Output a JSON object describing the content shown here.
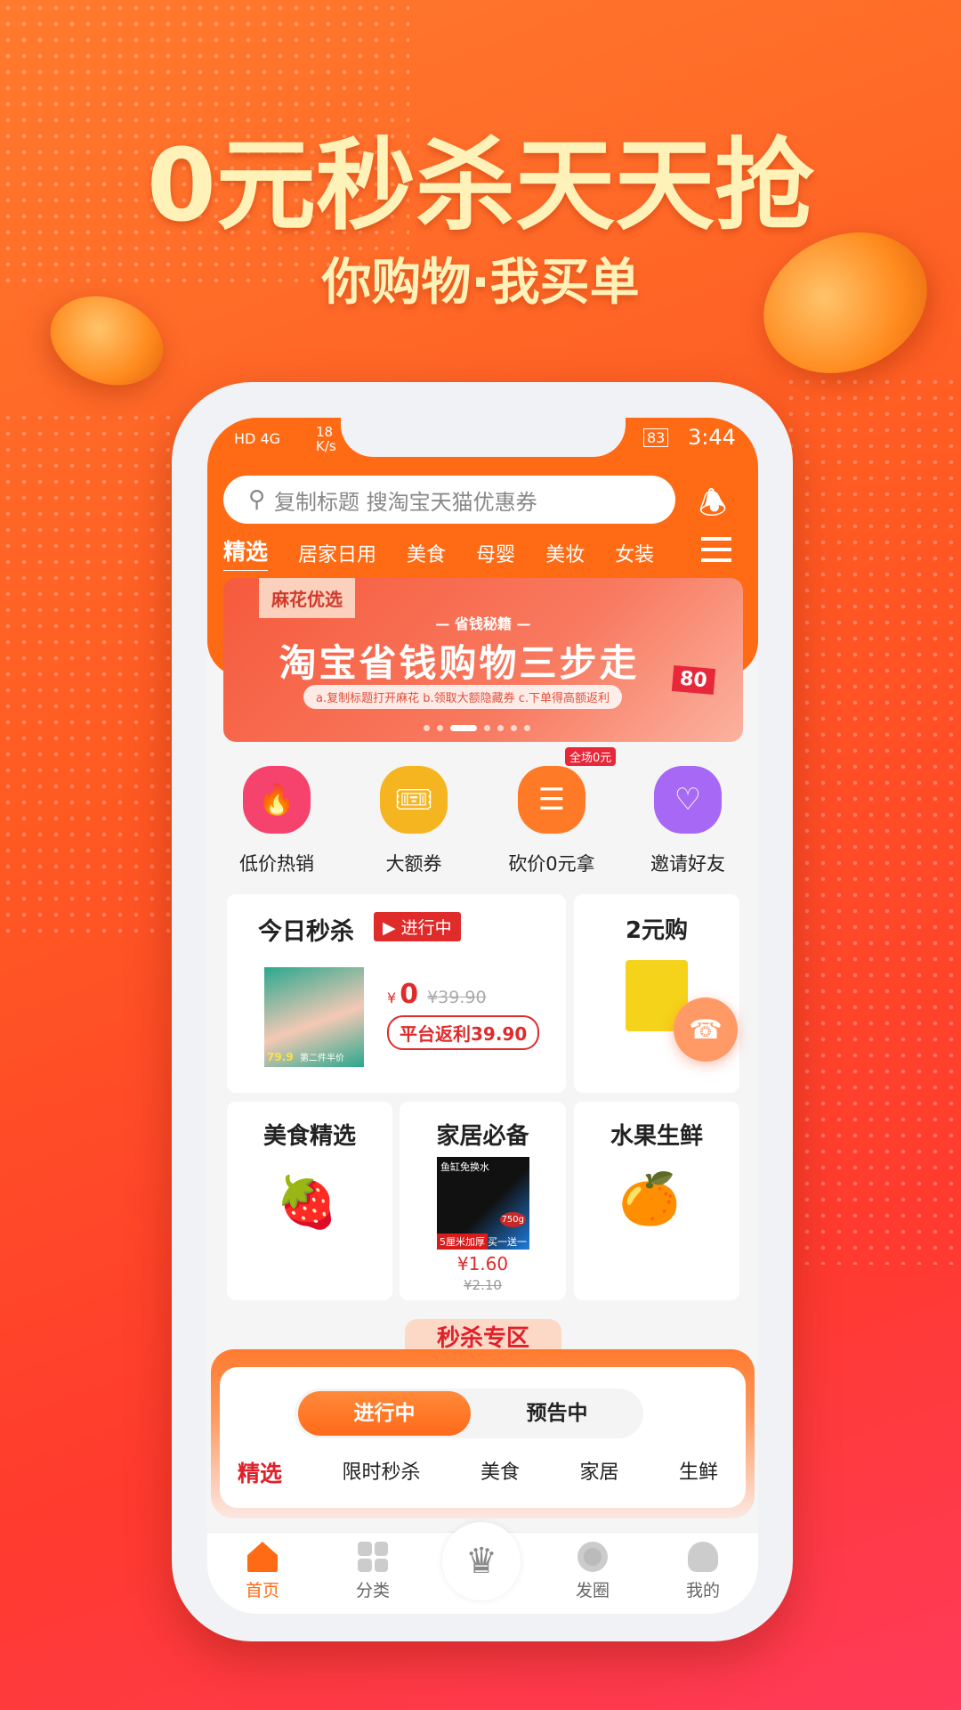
{
  "hero": {
    "title": "0元秒杀天天抢",
    "subtitle": "你购物·我买单"
  },
  "status_bar": {
    "left": "HD 4G",
    "speed": "18 K/s",
    "battery": "83",
    "time": "3:44"
  },
  "search": {
    "placeholder": "复制标题  搜淘宝天猫优惠券",
    "icon": "search-icon"
  },
  "tabs": [
    {
      "label": "精选",
      "active": true
    },
    {
      "label": "居家日用"
    },
    {
      "label": "美食"
    },
    {
      "label": "母婴"
    },
    {
      "label": "美妆"
    },
    {
      "label": "女装"
    }
  ],
  "banner": {
    "tag": "麻花优选",
    "kicker": "— 省钱秘籍 —",
    "title": "淘宝省钱购物三步走",
    "steps": "a.复制标题打开麻花 b.领取大额隐藏券 c.下单得高额返利",
    "coupon": "80",
    "active_dot": 2,
    "dot_count": 7
  },
  "quick": [
    {
      "label": "低价热销",
      "icon": "flame-icon",
      "color": "#f5436e"
    },
    {
      "label": "大额券",
      "icon": "ticket-icon",
      "color": "#f5b520"
    },
    {
      "label": "砍价0元拿",
      "icon": "coins-icon",
      "color": "#ff7a26",
      "badge": "全场0元"
    },
    {
      "label": "邀请好友",
      "icon": "invite-friend-icon",
      "color": "#a668f5"
    }
  ],
  "flash": {
    "title": "今日秒杀",
    "status": "进行中",
    "price_symbol": "¥",
    "price": "0",
    "original": "¥39.90",
    "rebate": "平台返利39.90",
    "product_price_tag": "79.9",
    "product_caption": "第二件半价"
  },
  "two_yuan": {
    "title": "2元购"
  },
  "categories": [
    {
      "title": "美食精选"
    },
    {
      "title": "家居必备",
      "price": "¥1.60",
      "original": "¥2.10",
      "tag": "鱼缸免换水",
      "sub": "5厘米加厚",
      "promo": "买一送一",
      "weight": "750g"
    },
    {
      "title": "水果生鲜"
    }
  ],
  "zone": {
    "title": "秒杀专区",
    "toggle": [
      {
        "label": "进行中",
        "active": true
      },
      {
        "label": "预告中"
      }
    ],
    "tabs": [
      {
        "label": "精选",
        "active": true
      },
      {
        "label": "限时秒杀"
      },
      {
        "label": "美食"
      },
      {
        "label": "家居"
      },
      {
        "label": "生鲜"
      }
    ]
  },
  "nav": [
    {
      "label": "首页",
      "active": true,
      "icon": "home-icon"
    },
    {
      "label": "分类",
      "icon": "category-icon"
    },
    {
      "label": "",
      "icon": "crown-icon"
    },
    {
      "label": "发圈",
      "icon": "share-circle-icon"
    },
    {
      "label": "我的",
      "icon": "profile-icon"
    }
  ],
  "colors": {
    "accent": "#ff6a14",
    "red": "#e02b2b"
  }
}
